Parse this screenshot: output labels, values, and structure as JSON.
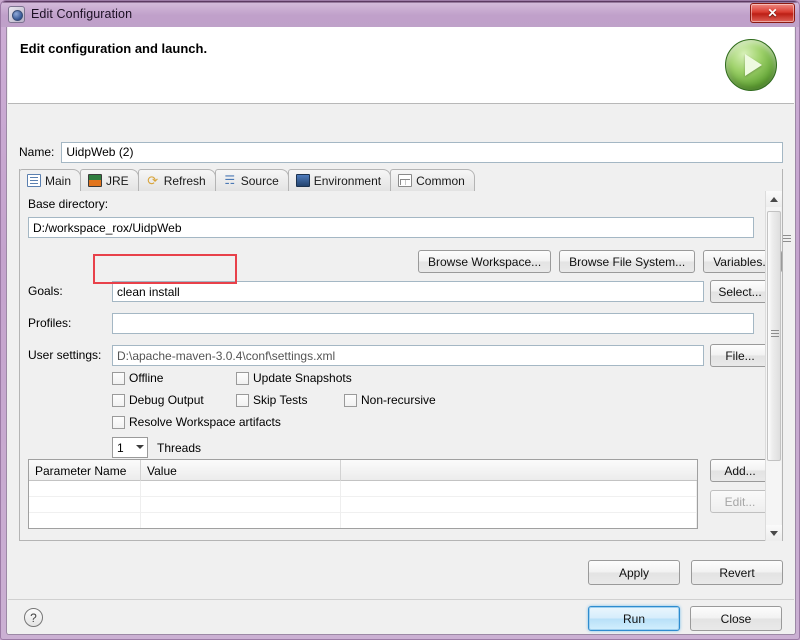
{
  "window": {
    "title": "Edit Configuration",
    "ghost_title": "",
    "close_label": "✕",
    "close_icon": "close-icon",
    "app_icon": "edit-configuration-icon"
  },
  "header": {
    "title": "Edit configuration and launch.",
    "message": "",
    "run_icon": "green-run-play-icon"
  },
  "name": {
    "label": "Name:",
    "value": "UidpWeb (2)",
    "placeholder": ""
  },
  "tabs": [
    {
      "label": "Main",
      "icon": "main-tab-icon",
      "active": true
    },
    {
      "label": "JRE",
      "icon": "jre-tab-icon",
      "active": false
    },
    {
      "label": "Refresh",
      "icon": "refresh-tab-icon",
      "active": false
    },
    {
      "label": "Source",
      "icon": "source-tab-icon",
      "active": false
    },
    {
      "label": "Environment",
      "icon": "environment-tab-icon",
      "active": false
    },
    {
      "label": "Common",
      "icon": "common-tab-icon",
      "active": false
    }
  ],
  "main": {
    "base_directory": {
      "label": "Base directory:",
      "value": "D:/workspace_rox/UidpWeb"
    },
    "browse_buttons": [
      {
        "label": "Browse Workspace...",
        "name": "browse-workspace-button"
      },
      {
        "label": "Browse File System...",
        "name": "browse-file-system-button"
      },
      {
        "label": "Variables...",
        "name": "variables-button"
      }
    ],
    "goals": {
      "label": "Goals:",
      "value": "clean install",
      "button": "Select...",
      "highlighted": true
    },
    "profiles": {
      "label": "Profiles:",
      "value": ""
    },
    "user_settings": {
      "label": "User settings:",
      "value": "D:\\apache-maven-3.0.4\\conf\\settings.xml",
      "button": "File..."
    },
    "checkboxes": [
      {
        "label": "Offline",
        "checked": false,
        "name": "offline-checkbox"
      },
      {
        "label": "Update Snapshots",
        "checked": false,
        "name": "update-snapshots-checkbox"
      },
      {
        "label": "Debug Output",
        "checked": false,
        "name": "debug-output-checkbox"
      },
      {
        "label": "Skip Tests",
        "checked": false,
        "name": "skip-tests-checkbox"
      },
      {
        "label": "Non-recursive",
        "checked": false,
        "name": "non-recursive-checkbox"
      },
      {
        "label": "Resolve Workspace artifacts",
        "checked": false,
        "name": "resolve-workspace-artifacts-checkbox"
      }
    ],
    "threads": {
      "value": "1",
      "label": "Threads"
    },
    "parameter_table": {
      "columns": [
        "Parameter Name",
        "Value"
      ],
      "rows": [],
      "add_button": "Add...",
      "edit_button": "Edit...",
      "edit_enabled": false
    }
  },
  "apply_row": {
    "apply": "Apply",
    "revert": "Revert"
  },
  "footer": {
    "help": "?",
    "run": "Run",
    "close": "Close"
  },
  "colors": {
    "accent": "#2e8ccf",
    "annotation": "#e8414a",
    "titlebar": "#c0a0ca",
    "run_green": "#5fa233"
  }
}
